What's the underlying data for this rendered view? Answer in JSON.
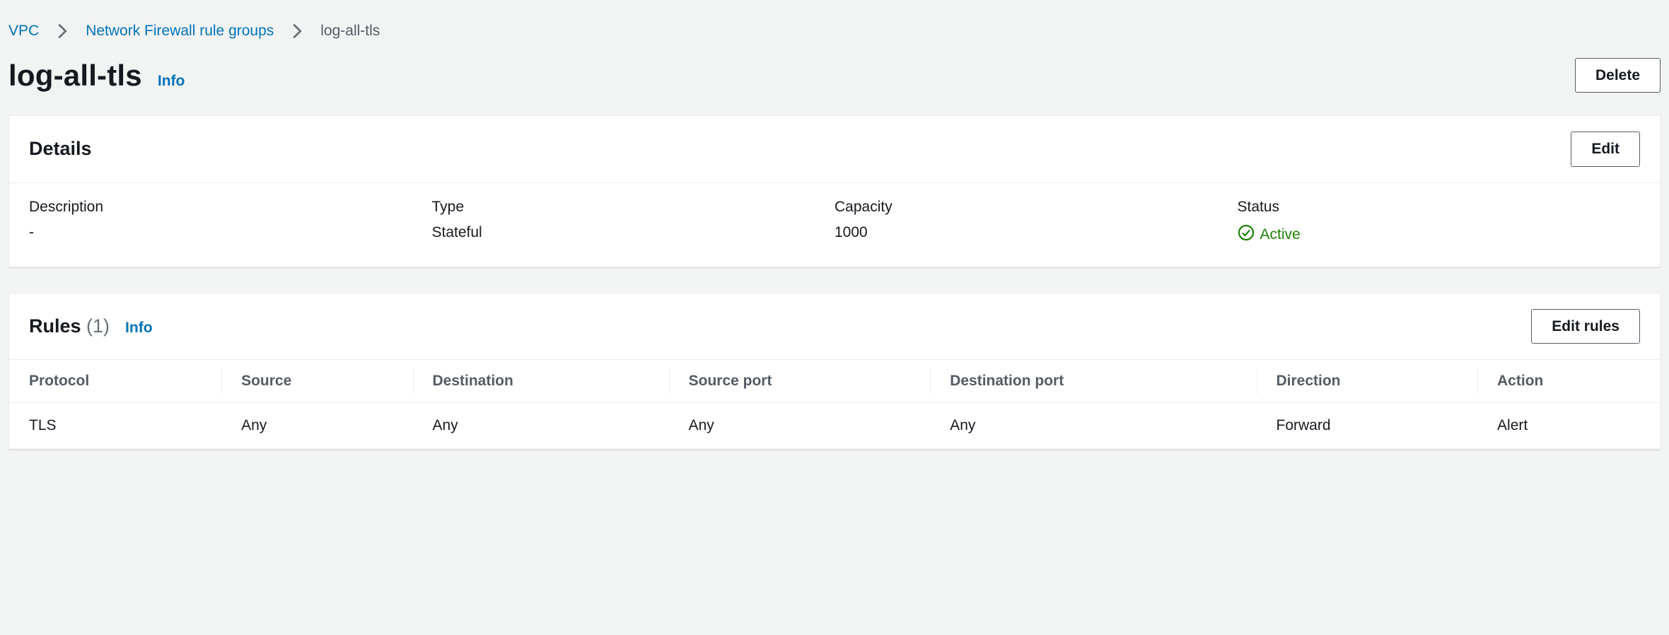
{
  "breadcrumb": {
    "items": [
      {
        "label": "VPC",
        "link": true
      },
      {
        "label": "Network Firewall rule groups",
        "link": true
      },
      {
        "label": "log-all-tls",
        "link": false
      }
    ]
  },
  "header": {
    "title": "log-all-tls",
    "info": "Info",
    "delete_label": "Delete"
  },
  "details": {
    "panel_title": "Details",
    "edit_label": "Edit",
    "fields": {
      "description": {
        "label": "Description",
        "value": "-"
      },
      "type": {
        "label": "Type",
        "value": "Stateful"
      },
      "capacity": {
        "label": "Capacity",
        "value": "1000"
      },
      "status": {
        "label": "Status",
        "value": "Active",
        "status_color": "#1d8102"
      }
    }
  },
  "rules": {
    "panel_title": "Rules",
    "count_display": "(1)",
    "info": "Info",
    "edit_label": "Edit rules",
    "columns": {
      "protocol": "Protocol",
      "source": "Source",
      "destination": "Destination",
      "source_port": "Source port",
      "destination_port": "Destination port",
      "direction": "Direction",
      "action": "Action"
    },
    "rows": [
      {
        "protocol": "TLS",
        "source": "Any",
        "destination": "Any",
        "source_port": "Any",
        "destination_port": "Any",
        "direction": "Forward",
        "action": "Alert"
      }
    ]
  }
}
